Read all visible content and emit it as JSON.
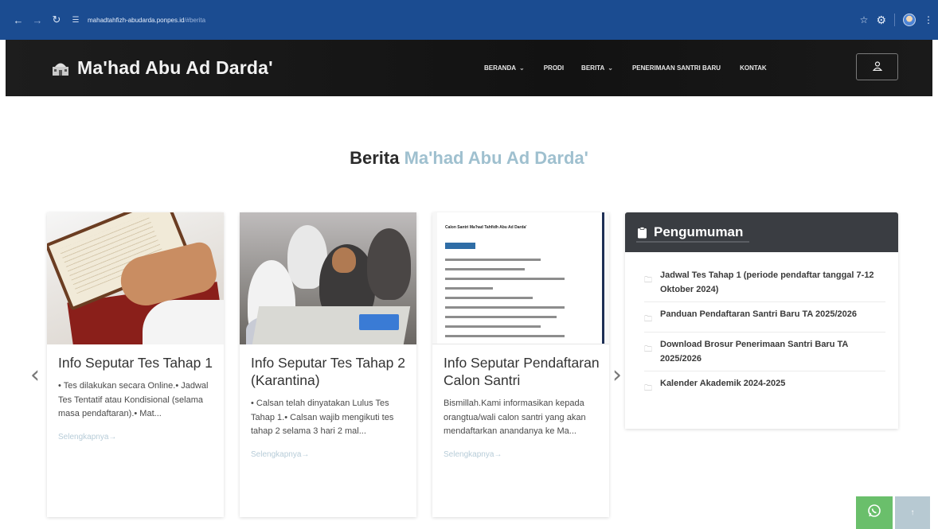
{
  "browser": {
    "url_host": "mahadtahfizh-abudarda.ponpes.id",
    "url_path": "/#berita",
    "icons": [
      "back-icon",
      "forward-icon",
      "reload-icon",
      "site-settings-icon",
      "bookmark-star-icon",
      "extensions-icon",
      "profile-avatar",
      "menu-icon"
    ]
  },
  "header": {
    "brand_title": "Ma'had Abu Ad Darda'",
    "nav": [
      {
        "label": "BERANDA",
        "has_dropdown": true
      },
      {
        "label": "PRODI",
        "has_dropdown": false
      },
      {
        "label": "BERITA",
        "has_dropdown": true
      },
      {
        "label": "PENERIMAAN SANTRI BARU",
        "has_dropdown": false
      },
      {
        "label": "KONTAK",
        "has_dropdown": false
      }
    ]
  },
  "section": {
    "title_dark": "Berita",
    "title_light": "Ma'had Abu Ad Darda'"
  },
  "cards": [
    {
      "title": "Info Seputar Tes Tahap 1",
      "excerpt": "• Tes dilakukan secara Online.• Jadwal Tes Tentatif atau Kondisional (selama masa pendaftaran).• Mat...",
      "more": "Selengkapnya→"
    },
    {
      "title": "Info Seputar Tes Tahap 2 (Karantina)",
      "excerpt": "• Calsan telah dinyatakan Lulus Tes Tahap 1.• Calsan wajib mengikuti tes tahap 2 selama 3 hari 2 mal...",
      "more": "Selengkapnya→"
    },
    {
      "title": "Info Seputar Pendaftaran Calon Santri",
      "excerpt": "Bismillah.Kami informasikan kepada orangtua/wali calon santri yang akan mendaftarkan anandanya ke Ma...",
      "more": "Selengkapnya→",
      "thumb_heading": "Calon Santri Ma'had Tahfidh Abu Ad Darda'"
    }
  ],
  "announcements": {
    "title": "Pengumuman",
    "items": [
      "Jadwal Tes Tahap 1 (periode pendaftar tanggal 7-12 Oktober 2024)",
      "Panduan Pendaftaran Santri Baru TA 2025/2026",
      "Download Brosur Penerimaan Santri Baru TA 2025/2026",
      "Kalender Akademik 2024-2025"
    ]
  },
  "colors": {
    "browser_bar": "#1b4c91",
    "header_bg": "#141414",
    "title_accent": "#9fc0cf",
    "whatsapp": "#6abf6b",
    "back_to_top": "#b7c9d2"
  }
}
